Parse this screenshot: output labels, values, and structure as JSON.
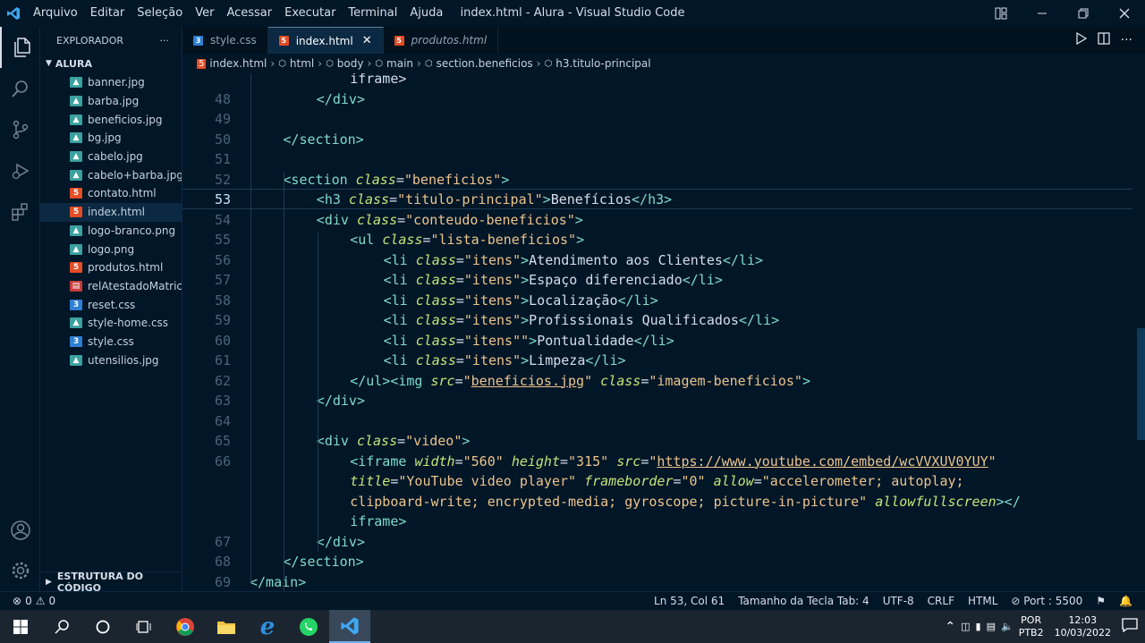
{
  "titlebar": {
    "menu": [
      "Arquivo",
      "Editar",
      "Seleção",
      "Ver",
      "Acessar",
      "Executar",
      "Terminal",
      "Ajuda"
    ],
    "title": "index.html - Alura - Visual Studio Code"
  },
  "sidebar": {
    "header": "EXPLORADOR",
    "more": "···",
    "folder": "ALURA",
    "files": [
      {
        "name": "banner.jpg",
        "type": "img"
      },
      {
        "name": "barba.jpg",
        "type": "img"
      },
      {
        "name": "beneficios.jpg",
        "type": "img"
      },
      {
        "name": "bg.jpg",
        "type": "img"
      },
      {
        "name": "cabelo.jpg",
        "type": "img"
      },
      {
        "name": "cabelo+barba.jpg",
        "type": "img"
      },
      {
        "name": "contato.html",
        "type": "html"
      },
      {
        "name": "index.html",
        "type": "html"
      },
      {
        "name": "logo-branco.png",
        "type": "img"
      },
      {
        "name": "logo.png",
        "type": "img"
      },
      {
        "name": "produtos.html",
        "type": "html"
      },
      {
        "name": "relAtestadoMatric...",
        "type": "pdf"
      },
      {
        "name": "reset.css",
        "type": "css"
      },
      {
        "name": "style-home.css",
        "type": "img"
      },
      {
        "name": "style.css",
        "type": "css"
      },
      {
        "name": "utensilios.jpg",
        "type": "img"
      }
    ],
    "selected_index": 7,
    "outline": "ESTRUTURA DO CÓDIGO"
  },
  "tabs": [
    {
      "label": "style.css",
      "icon": "css",
      "active": false,
      "italic": false
    },
    {
      "label": "index.html",
      "icon": "html",
      "active": true,
      "italic": false
    },
    {
      "label": "produtos.html",
      "icon": "html",
      "active": false,
      "italic": true
    }
  ],
  "breadcrumb": [
    "index.html",
    "html",
    "body",
    "main",
    "section.beneficios",
    "h3.titulo-principal"
  ],
  "editor": {
    "current_line": "53"
  },
  "status": {
    "errors": "0",
    "warnings": "0",
    "position": "Ln 53, Col 61",
    "tab_size": "Tamanho da Tecla Tab: 4",
    "encoding": "UTF-8",
    "eol": "CRLF",
    "language": "HTML",
    "port": "Port : 5500"
  },
  "taskbar": {
    "lang1": "POR",
    "lang2": "PTB2",
    "time": "12:03",
    "date": "10/03/2022"
  },
  "colors": {
    "background": "#011627",
    "tag": "#7fdbca",
    "attribute": "#c5e478",
    "string": "#ecc48d"
  }
}
